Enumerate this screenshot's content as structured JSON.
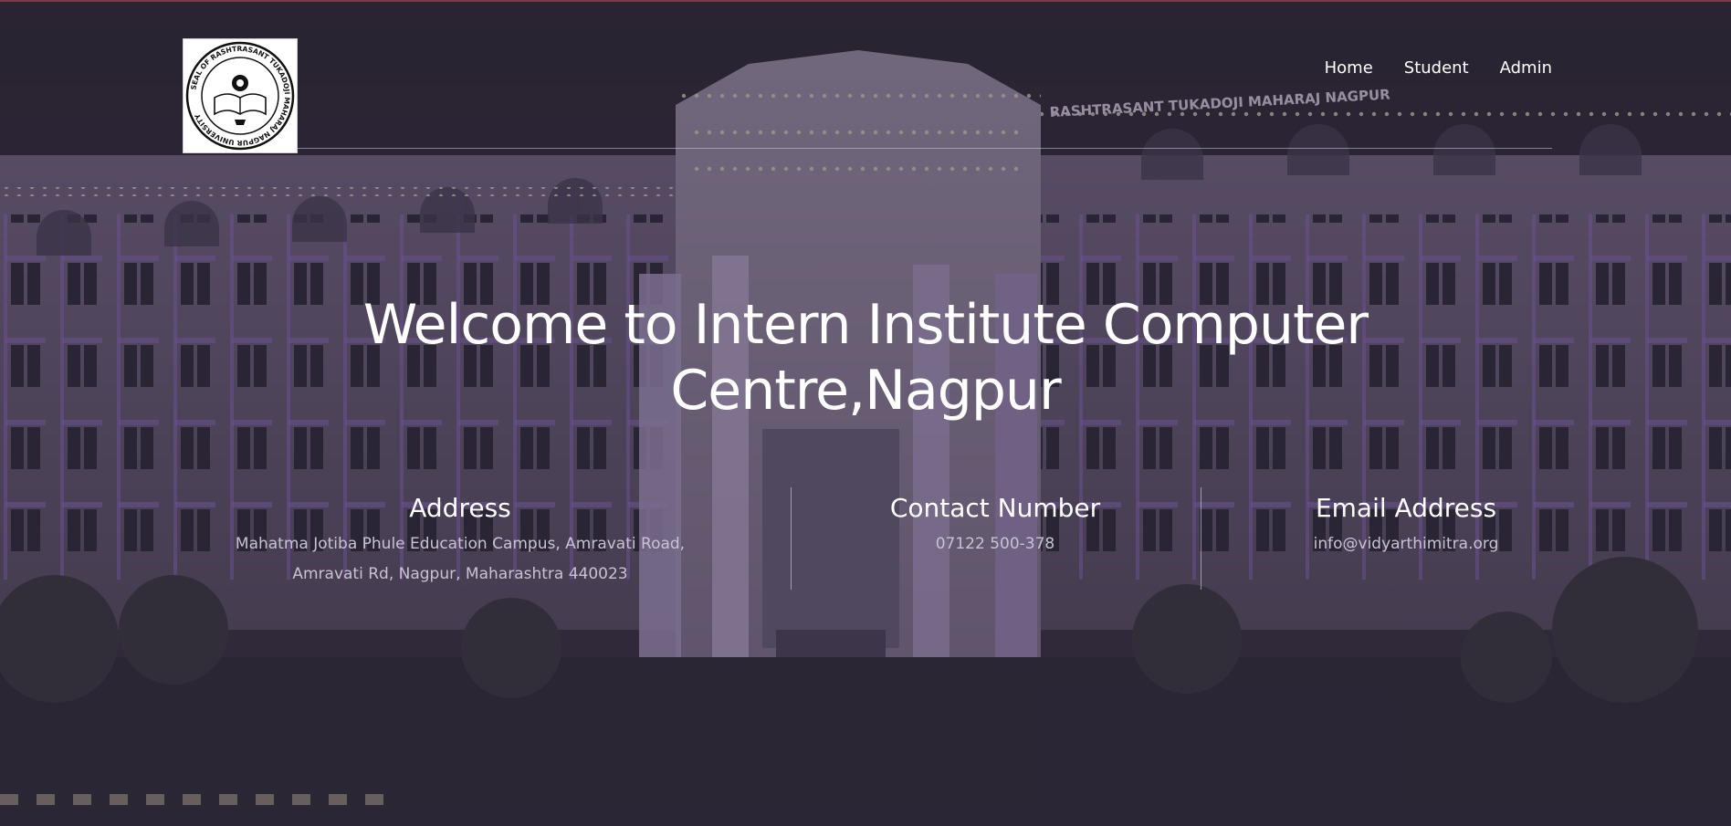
{
  "colors": {
    "overlay": "#3c3849",
    "building_glow": "#8a5fc9",
    "text_primary": "#ffffff",
    "text_muted": "#c8c3d2"
  },
  "header": {
    "logo": {
      "icon": "university-seal-icon",
      "seal_text": "SEAL OF RASHTRASANT TUKADOJI MAHARAJ NAGPUR UNIVERSITY"
    },
    "nav": [
      {
        "label": "Home"
      },
      {
        "label": "Student"
      },
      {
        "label": "Admin"
      }
    ]
  },
  "hero": {
    "title_line1": "Welcome to Intern Institute Computer",
    "title_line2": "Centre,Nagpur"
  },
  "info": {
    "address": {
      "title": "Address",
      "line1": "Mahatma Jotiba Phule Education Campus, Amravati Road,",
      "line2": "Amravati Rd, Nagpur, Maharashtra 440023"
    },
    "contact": {
      "title": "Contact Number",
      "value": "07122 500-378"
    },
    "email": {
      "title": "Email Address",
      "value": "info@vidyarthimitra.org"
    }
  },
  "background": {
    "building_sign_left": "RASHTRASANT TUKADOJI MAHARAJ NAGPUR"
  }
}
